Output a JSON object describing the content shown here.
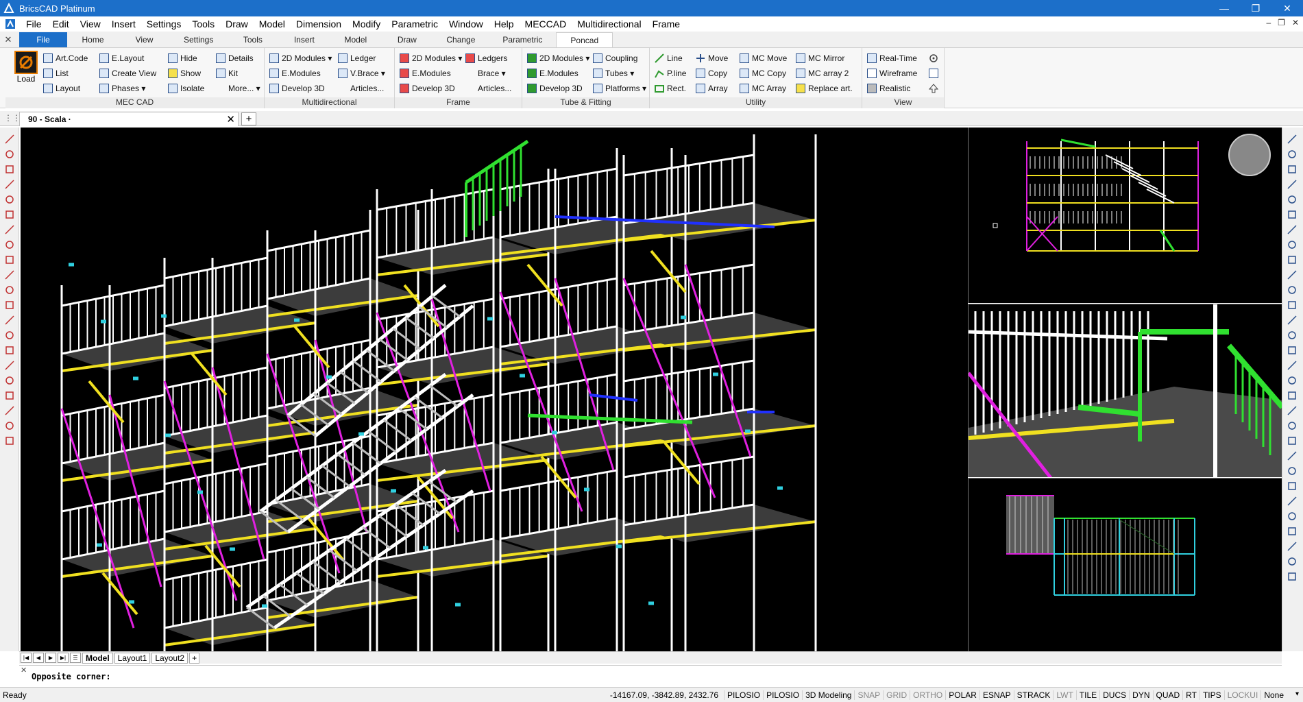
{
  "titlebar": {
    "title": "BricsCAD Platinum",
    "minimize": "—",
    "maximize": "❐",
    "close": "✕"
  },
  "menubar": {
    "items": [
      "File",
      "Edit",
      "View",
      "Insert",
      "Settings",
      "Tools",
      "Draw",
      "Model",
      "Dimension",
      "Modify",
      "Parametric",
      "Window",
      "Help",
      "MECCAD",
      "Multidirectional",
      "Frame"
    ],
    "doc_min": "–",
    "doc_restore": "❐",
    "doc_close": "✕"
  },
  "ribbon_tabs": {
    "close": "✕",
    "items": [
      "File",
      "Home",
      "View",
      "Settings",
      "Tools",
      "Insert",
      "Model",
      "Draw",
      "Change",
      "Parametric",
      "Poncad"
    ],
    "active": "Poncad"
  },
  "ribbon": {
    "meccad": {
      "label": "MEC CAD",
      "load": "Load",
      "col1": [
        "Art.Code",
        "List",
        "Layout"
      ],
      "col2": [
        "E.Layout",
        "Create View",
        "Phases ▾"
      ],
      "col3": [
        "Hide",
        "Show",
        "Isolate"
      ],
      "col4": [
        "Details",
        "Kit",
        "More... ▾"
      ]
    },
    "multidirectional": {
      "label": "Multidirectional",
      "col1": [
        "2D Modules ▾",
        "E.Modules",
        "Develop 3D"
      ],
      "col2": [
        "Ledger",
        "V.Brace ▾",
        "Articles..."
      ]
    },
    "frame": {
      "label": "Frame",
      "col1": [
        "2D Modules ▾",
        "E.Modules",
        "Develop 3D"
      ],
      "col2": [
        "Ledgers",
        "Brace ▾",
        "Articles..."
      ]
    },
    "tube": {
      "label": "Tube & Fitting",
      "col1": [
        "2D Modules ▾",
        "E.Modules",
        "Develop 3D"
      ],
      "col2": [
        "Coupling",
        "Tubes ▾",
        "Platforms ▾"
      ]
    },
    "utility": {
      "label": "Utility",
      "col1": [
        "Line",
        "P.line",
        "Rect."
      ],
      "col2": [
        "Move",
        "Copy",
        "Array"
      ],
      "col3": [
        "MC Move",
        "MC Copy",
        "MC Array"
      ],
      "col4": [
        "MC Mirror",
        "MC array 2",
        "Replace art."
      ]
    },
    "view": {
      "label": "View",
      "col1": [
        "Real-Time",
        "Wireframe",
        "Realistic"
      ]
    }
  },
  "doc_tab": {
    "title": "90 - Scala ·",
    "close": "✕",
    "new": "+"
  },
  "layout_tabs": {
    "nav": [
      "|◀",
      "◀",
      "▶",
      "▶|"
    ],
    "tabs": [
      "Model",
      "Layout1",
      "Layout2"
    ],
    "active": "Model",
    "add": "+"
  },
  "command": {
    "close": "✕",
    "prompt": "Opposite corner:"
  },
  "statusbar": {
    "ready": "Ready",
    "coords": "-14167.09, -3842.89, 2432.76",
    "buttons": [
      {
        "label": "PILOSIO",
        "on": true
      },
      {
        "label": "PILOSIO",
        "on": true
      },
      {
        "label": "3D Modeling",
        "on": true
      },
      {
        "label": "SNAP",
        "on": false
      },
      {
        "label": "GRID",
        "on": false
      },
      {
        "label": "ORTHO",
        "on": false
      },
      {
        "label": "POLAR",
        "on": true
      },
      {
        "label": "ESNAP",
        "on": true
      },
      {
        "label": "STRACK",
        "on": true
      },
      {
        "label": "LWT",
        "on": false
      },
      {
        "label": "TILE",
        "on": true
      },
      {
        "label": "DUCS",
        "on": true
      },
      {
        "label": "DYN",
        "on": true
      },
      {
        "label": "QUAD",
        "on": true
      },
      {
        "label": "RT",
        "on": true
      },
      {
        "label": "TIPS",
        "on": true
      },
      {
        "label": "LOCKUI",
        "on": false
      },
      {
        "label": "None",
        "on": true
      }
    ],
    "dropdown": "▾"
  },
  "colors": {
    "titlebar": "#1c6fc9",
    "canvas": "#000000",
    "scaffold_white": "#ffffff",
    "brace_magenta": "#e020e0",
    "yellow": "#f0e020",
    "green": "#30e030",
    "cyan": "#30d0e0",
    "blue": "#2030ff"
  }
}
